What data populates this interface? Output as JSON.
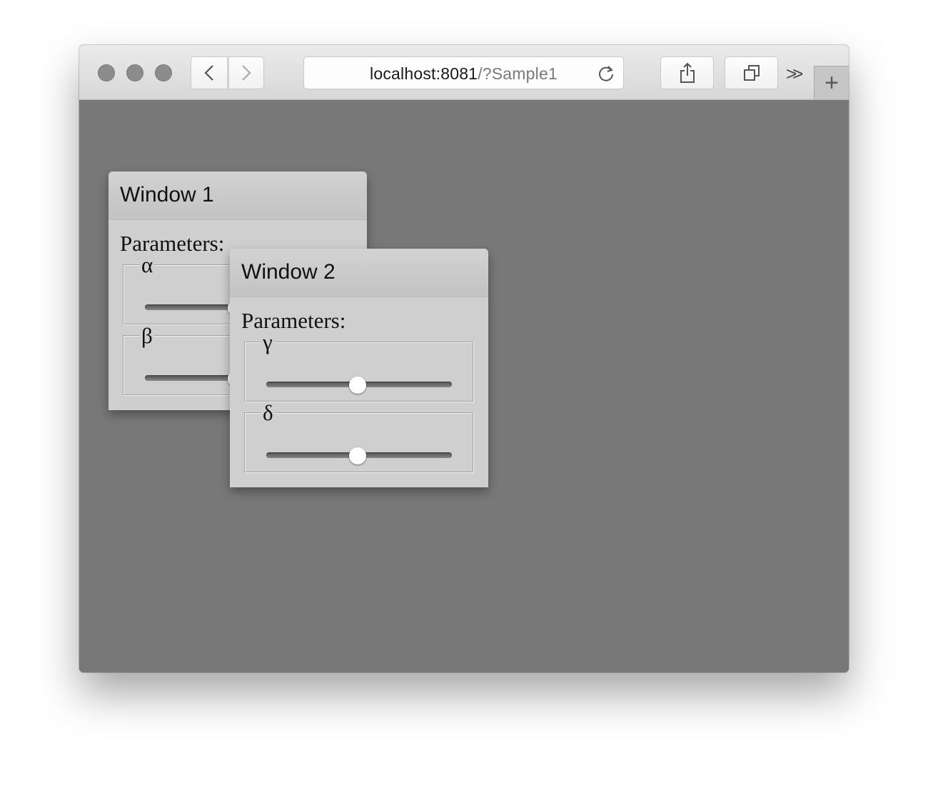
{
  "browser": {
    "url_host": "localhost:8081",
    "url_path": "/?Sample1",
    "overflow_label": ">>",
    "new_tab_label": "+"
  },
  "windows": [
    {
      "title": "Window 1",
      "section_label": "Parameters:",
      "params": [
        {
          "symbol": "α",
          "value": 0.5
        },
        {
          "symbol": "β",
          "value": 0.5
        }
      ]
    },
    {
      "title": "Window 2",
      "section_label": "Parameters:",
      "params": [
        {
          "symbol": "γ",
          "value": 0.5
        },
        {
          "symbol": "δ",
          "value": 0.5
        }
      ]
    }
  ]
}
